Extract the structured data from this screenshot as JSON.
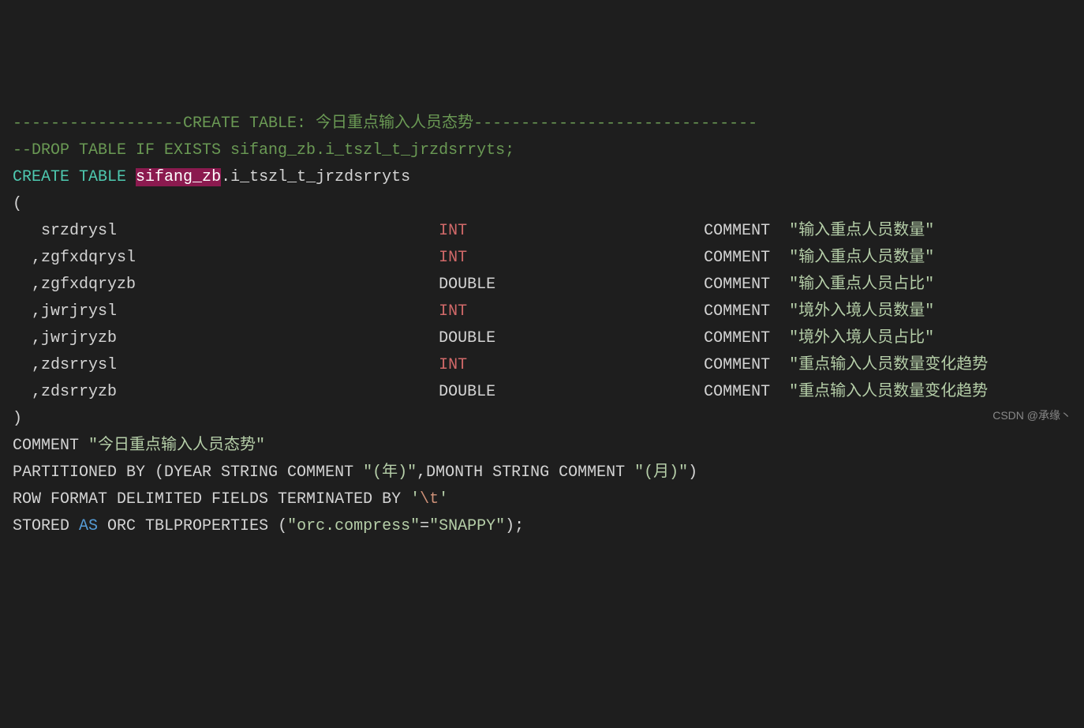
{
  "line1": {
    "prefix": "------------------CREATE TABLE: ",
    "title": "今日重点输入人员态势",
    "suffix": "------------------------------"
  },
  "line2": "--DROP TABLE IF EXISTS sifang_zb.i_tszl_t_jrzdsrryts;",
  "create": {
    "kw": "CREATE TABLE",
    "schema": "sifang_zb",
    "dot_table": ".i_tszl_t_jrzdsrryts"
  },
  "columns": [
    {
      "lead": "   ",
      "name": "srzdrysl",
      "type": "INT",
      "commentKw": "COMMENT",
      "comment": "\"输入重点人员数量\""
    },
    {
      "lead": "  ,",
      "name": "zgfxdqrysl",
      "type": "INT",
      "commentKw": "COMMENT",
      "comment": "\"输入重点人员数量\""
    },
    {
      "lead": "  ,",
      "name": "zgfxdqryzb",
      "type": "DOUBLE",
      "commentKw": "COMMENT",
      "comment": "\"输入重点人员占比\""
    },
    {
      "lead": "  ,",
      "name": "jwrjrysl",
      "type": "INT",
      "commentKw": "COMMENT",
      "comment": "\"境外入境人员数量\""
    },
    {
      "lead": "  ,",
      "name": "jwrjryzb",
      "type": "DOUBLE",
      "commentKw": "COMMENT",
      "comment": "\"境外入境人员占比\""
    },
    {
      "lead": "  ,",
      "name": "zdsrrysl",
      "type": "INT",
      "commentKw": "COMMENT",
      "comment": "\"重点输入人员数量变化趋势"
    },
    {
      "lead": "  ,",
      "name": "zdsrryzb",
      "type": "DOUBLE",
      "commentKw": "COMMENT",
      "comment": "\"重点输入人员数量变化趋势"
    }
  ],
  "paren_open": "(",
  "paren_close": ")",
  "tableComment": {
    "kw": "COMMENT ",
    "val": "\"今日重点输入人员态势\""
  },
  "partition": {
    "p1": "PARTITIONED BY (DYEAR STRING COMMENT ",
    "y": "\"(年)\"",
    "mid": ",DMONTH STRING COMMENT ",
    "m": "\"(月)\"",
    "end": ")"
  },
  "rowformat": {
    "p1": "ROW FORMAT DELIMITED FIELDS TERMINATED BY ",
    "q1": "'",
    "esc": "\\t",
    "q2": "'"
  },
  "stored": {
    "p1": "STORED ",
    "as": "AS",
    "p2": " ORC TBLPROPERTIES (",
    "k": "\"orc.compress\"",
    "eq": "=",
    "v": "\"SNAPPY\"",
    "end": ");"
  },
  "watermark": "CSDN @承缘丶"
}
